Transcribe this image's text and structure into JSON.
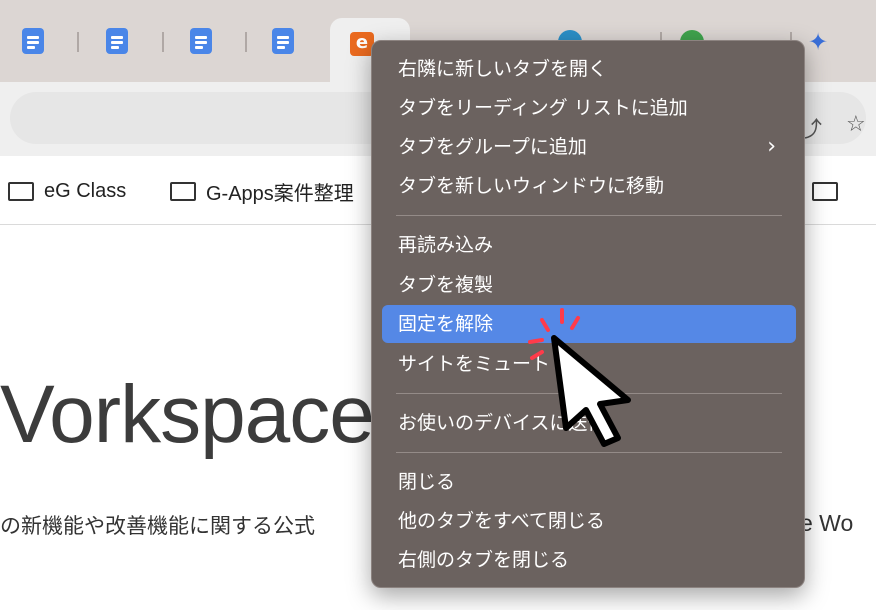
{
  "tabs": {
    "active_favicon_letter": "e"
  },
  "bookmarks": [
    {
      "label": "eG Class"
    },
    {
      "label": "G-Apps案件整理"
    }
  ],
  "page": {
    "title_fragment": "Vorkspace",
    "subtitle_fragment": "の新機能や改善機能に関する公式",
    "subtitle_right_fragment": "e Wo"
  },
  "context_menu": {
    "groups": [
      [
        {
          "label": "右隣に新しいタブを開く"
        },
        {
          "label": "タブをリーディング リストに追加"
        },
        {
          "label": "タブをグループに追加",
          "has_submenu": true
        },
        {
          "label": "タブを新しいウィンドウに移動"
        }
      ],
      [
        {
          "label": "再読み込み"
        },
        {
          "label": "タブを複製"
        },
        {
          "label": "固定を解除",
          "highlighted": true
        },
        {
          "label": "サイトをミュート"
        }
      ],
      [
        {
          "label": "お使いのデバイスに送信"
        }
      ],
      [
        {
          "label": "閉じる"
        },
        {
          "label": "他のタブをすべて閉じる"
        },
        {
          "label": "右側のタブを閉じる"
        }
      ]
    ],
    "submenu_icon": "chevron-right-icon"
  },
  "colors": {
    "menu_background": "#6b625f",
    "menu_highlight": "#5588e6",
    "tabstrip": "#dcd6d3",
    "pinned_doc_favicon": "#4a86e8",
    "active_favicon": "#ea6a1f"
  },
  "icons": [
    "docs-icon",
    "folder-icon",
    "chevron-right-icon",
    "sparkle-icon",
    "mouse-cursor-icon",
    "click-burst-icon"
  ]
}
